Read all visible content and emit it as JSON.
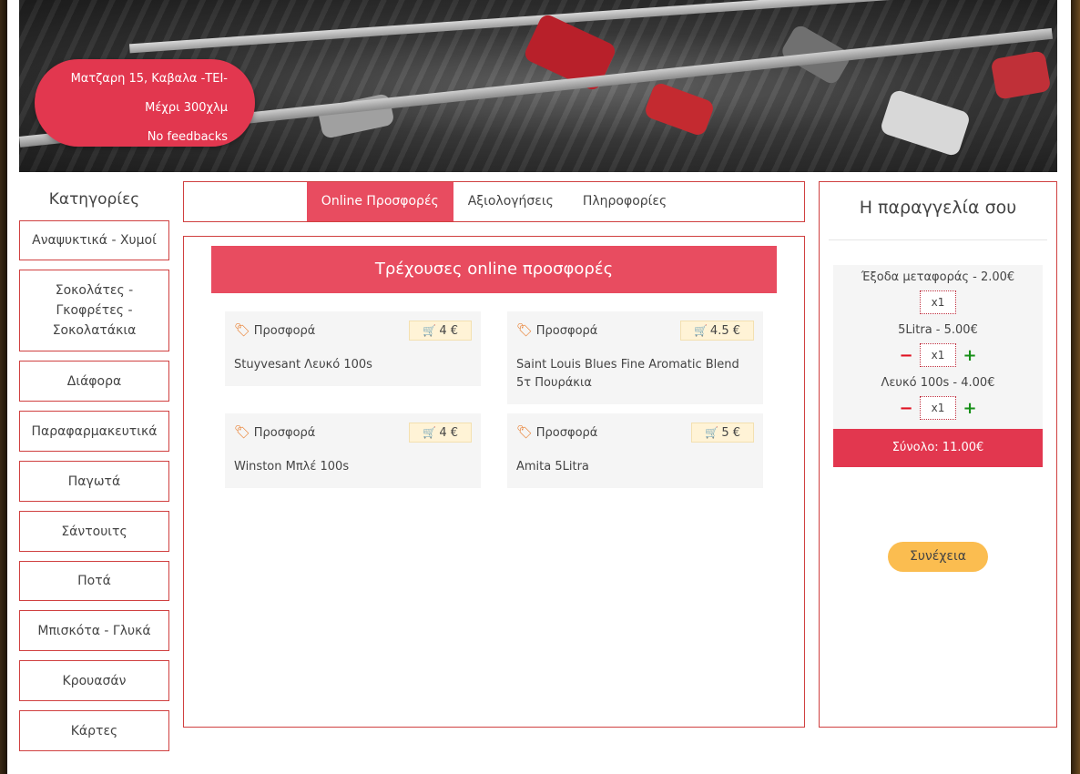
{
  "hero": {
    "address": "Ματζαρη 15, Καβαλα -ΤΕΙ-",
    "distance": "Μέχρι 300χλμ",
    "feedback": "No feedbacks"
  },
  "sidebar": {
    "title": "Κατηγορίες",
    "items": [
      "Αναψυκτικά - Χυμοί",
      "Σοκολάτες - Γκοφρέτες - Σοκολατάκια",
      "Διάφορα",
      "Παραφαρμακευτικά",
      "Παγωτά",
      "Σάντουιτς",
      "Ποτά",
      "Μπισκότα - Γλυκά",
      "Κρουασάν",
      "Κάρτες"
    ]
  },
  "tabs": [
    "Online Προσφορές",
    "Αξιολογήσεις",
    "Πληροφορίες"
  ],
  "content": {
    "heading": "Τρέχουσες online προσφορές",
    "offers": [
      {
        "label": "Προσφορά",
        "price": "4 €",
        "name": "Stuyvesant Λευκό 100s"
      },
      {
        "label": "Προσφορά",
        "price": "4.5 €",
        "name": "Saint Louis Blues Fine Aromatic Blend 5τ Πουράκια"
      },
      {
        "label": "Προσφορά",
        "price": "4 €",
        "name": "Winston Μπλέ 100s"
      },
      {
        "label": "Προσφορά",
        "price": "5 €",
        "name": "Amita 5Litra"
      }
    ]
  },
  "order": {
    "title": "Η παραγγελία σου",
    "items": [
      {
        "title": "Έξοδα μεταφοράς - 2.00€",
        "qty": "x1"
      },
      {
        "title": "5Litra - 5.00€",
        "qty": "x1"
      },
      {
        "title": "Λευκό 100s - 4.00€",
        "qty": "x1"
      }
    ],
    "minus": "−",
    "plus": "+",
    "total": "Σύνολο: 11.00€",
    "continue": "Συνέχεια"
  }
}
